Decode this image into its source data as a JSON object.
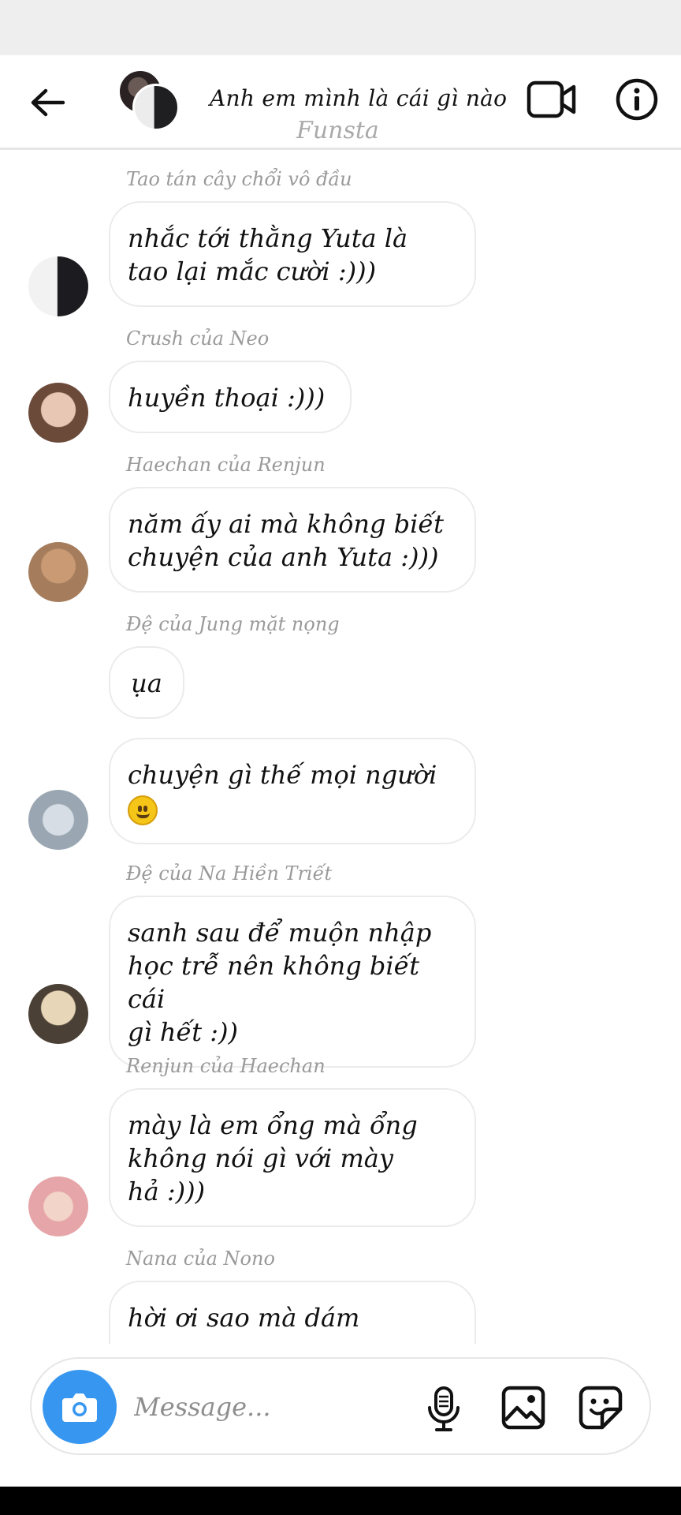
{
  "header": {
    "title": "Anh em mình là cái gì nào",
    "subtitle": "Funsta",
    "back_icon": "arrow-left-icon",
    "video_icon": "video-camera-icon",
    "info_icon": "info-icon"
  },
  "messages": [
    {
      "sender": "Tao tán cây chổi vô đầu",
      "lines": [
        "nhắc tới thằng Yuta là",
        "tao lại mắc cười :)))"
      ]
    },
    {
      "sender": "Crush của Neo",
      "lines": [
        "huyền thoại :)))"
      ]
    },
    {
      "sender": "Haechan của Renjun",
      "lines": [
        "năm ấy ai mà không biết",
        "chuyện của anh Yuta :)))"
      ]
    },
    {
      "sender": "Đệ của Jung mặt nọng",
      "lines": [
        "ụa"
      ],
      "lines2": [
        "chuyện gì thế mọi người"
      ]
    },
    {
      "sender": "Đệ của Na Hiền Triết",
      "lines": [
        "sanh sau để muộn nhập",
        "học trễ nên không biết cái",
        "gì hết :))"
      ]
    },
    {
      "sender": "Renjun của Haechan",
      "lines": [
        "mày là em ổng mà ổng",
        "không nói gì với mày",
        "hả :)))"
      ]
    },
    {
      "sender": "Nana của Nono",
      "lines": [
        "hời ơi sao mà dám"
      ]
    }
  ],
  "composer": {
    "placeholder": "Message...",
    "camera_icon": "camera-icon",
    "mic_icon": "microphone-icon",
    "gallery_icon": "image-icon",
    "sticker_icon": "sticker-icon"
  },
  "colors": {
    "accent": "#3797f0",
    "bubble_border": "#ebebeb",
    "sender_text": "#9a9a9a"
  }
}
